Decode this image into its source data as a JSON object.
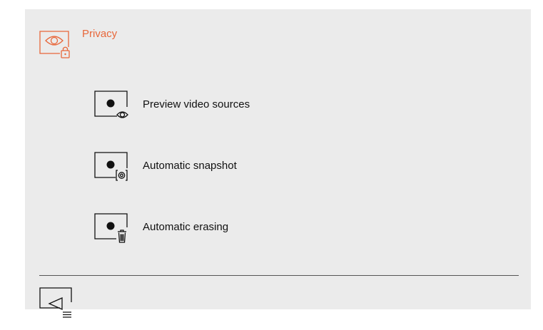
{
  "header": {
    "title": "Privacy",
    "icon": "privacy-eye-lock-icon"
  },
  "colors": {
    "accent": "#e8673a",
    "background": "#ebebeb",
    "text": "#111111",
    "divider": "#555555"
  },
  "menu": {
    "items": [
      {
        "label": "Preview video sources",
        "icon": "preview-video-eye-icon"
      },
      {
        "label": "Automatic snapshot",
        "icon": "snapshot-camera-icon"
      },
      {
        "label": "Automatic erasing",
        "icon": "erase-trash-icon"
      }
    ]
  },
  "footer": {
    "back_icon": "back-menu-icon"
  }
}
